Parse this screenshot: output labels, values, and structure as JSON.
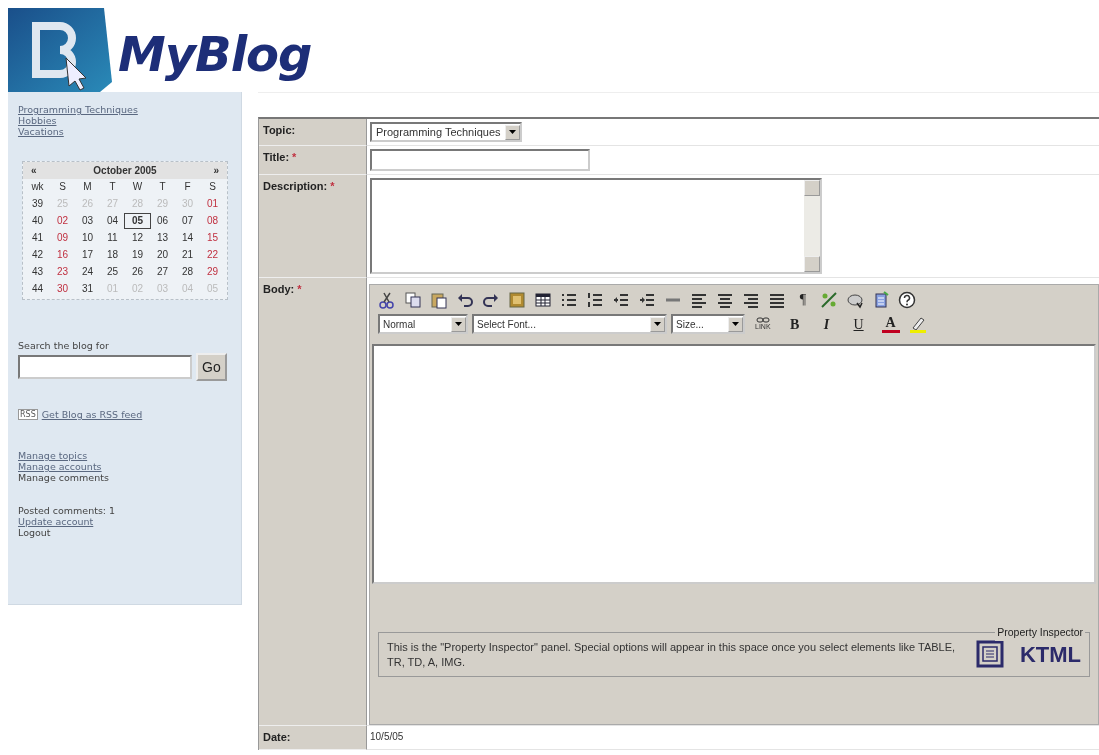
{
  "logo": {
    "text": "MyBlog"
  },
  "sidebar": {
    "topics": [
      {
        "text": "Programming Techniques"
      },
      {
        "text": "Hobbies"
      },
      {
        "text": "Vacations"
      }
    ],
    "calendar": {
      "prev": "«",
      "month": "October 2005",
      "next": "»",
      "headers": [
        "wk",
        "S",
        "M",
        "T",
        "W",
        "T",
        "F",
        "S"
      ],
      "weeks": [
        {
          "wk": "39",
          "days": [
            {
              "text": "25",
              "kind": "other",
              "selected": false
            },
            {
              "text": "26",
              "kind": "other",
              "selected": false
            },
            {
              "text": "27",
              "kind": "other",
              "selected": false
            },
            {
              "text": "28",
              "kind": "other",
              "selected": false
            },
            {
              "text": "29",
              "kind": "other",
              "selected": false
            },
            {
              "text": "30",
              "kind": "other",
              "selected": false
            },
            {
              "text": "01",
              "kind": "weekend",
              "selected": false
            }
          ]
        },
        {
          "wk": "40",
          "days": [
            {
              "text": "02",
              "kind": "weekend",
              "selected": false
            },
            {
              "text": "03",
              "kind": "normal",
              "selected": false
            },
            {
              "text": "04",
              "kind": "normal",
              "selected": false
            },
            {
              "text": "05",
              "kind": "normal",
              "selected": true
            },
            {
              "text": "06",
              "kind": "normal",
              "selected": false
            },
            {
              "text": "07",
              "kind": "normal",
              "selected": false
            },
            {
              "text": "08",
              "kind": "weekend",
              "selected": false
            }
          ]
        },
        {
          "wk": "41",
          "days": [
            {
              "text": "09",
              "kind": "weekend",
              "selected": false
            },
            {
              "text": "10",
              "kind": "normal",
              "selected": false
            },
            {
              "text": "11",
              "kind": "normal",
              "selected": false
            },
            {
              "text": "12",
              "kind": "normal",
              "selected": false
            },
            {
              "text": "13",
              "kind": "normal",
              "selected": false
            },
            {
              "text": "14",
              "kind": "normal",
              "selected": false
            },
            {
              "text": "15",
              "kind": "weekend",
              "selected": false
            }
          ]
        },
        {
          "wk": "42",
          "days": [
            {
              "text": "16",
              "kind": "weekend",
              "selected": false
            },
            {
              "text": "17",
              "kind": "normal",
              "selected": false
            },
            {
              "text": "18",
              "kind": "normal",
              "selected": false
            },
            {
              "text": "19",
              "kind": "normal",
              "selected": false
            },
            {
              "text": "20",
              "kind": "normal",
              "selected": false
            },
            {
              "text": "21",
              "kind": "normal",
              "selected": false
            },
            {
              "text": "22",
              "kind": "weekend",
              "selected": false
            }
          ]
        },
        {
          "wk": "43",
          "days": [
            {
              "text": "23",
              "kind": "weekend",
              "selected": false
            },
            {
              "text": "24",
              "kind": "normal",
              "selected": false
            },
            {
              "text": "25",
              "kind": "normal",
              "selected": false
            },
            {
              "text": "26",
              "kind": "normal",
              "selected": false
            },
            {
              "text": "27",
              "kind": "normal",
              "selected": false
            },
            {
              "text": "28",
              "kind": "normal",
              "selected": false
            },
            {
              "text": "29",
              "kind": "weekend",
              "selected": false
            }
          ]
        },
        {
          "wk": "44",
          "days": [
            {
              "text": "30",
              "kind": "weekend",
              "selected": false
            },
            {
              "text": "31",
              "kind": "normal",
              "selected": false
            },
            {
              "text": "01",
              "kind": "other",
              "selected": false
            },
            {
              "text": "02",
              "kind": "other",
              "selected": false
            },
            {
              "text": "03",
              "kind": "other",
              "selected": false
            },
            {
              "text": "04",
              "kind": "other",
              "selected": false
            },
            {
              "text": "05",
              "kind": "other",
              "selected": false
            }
          ]
        }
      ]
    },
    "search": {
      "label": "Search the blog for",
      "button": "Go"
    },
    "rss": {
      "badge": "RSS",
      "link": "Get Blog as RSS feed"
    },
    "admin_links": [
      {
        "text": "Manage topics",
        "kind": "link"
      },
      {
        "text": "Manage accounts",
        "kind": "link"
      },
      {
        "text": "Manage comments",
        "kind": "text"
      }
    ],
    "posted_comments": "Posted comments: 1",
    "account_links": [
      {
        "text": "Update account",
        "kind": "link"
      },
      {
        "text": "Logout",
        "kind": "text"
      }
    ]
  },
  "form": {
    "required_mark": "*",
    "rows": [
      {
        "label": "Topic:",
        "required": false,
        "kind": "select",
        "value": "Programming Techniques"
      },
      {
        "label": "Title:",
        "required": true,
        "kind": "text"
      },
      {
        "label": "Description:",
        "required": true,
        "kind": "textarea"
      },
      {
        "label": "Body:",
        "required": true,
        "kind": "editor"
      },
      {
        "label": "Date:",
        "required": false,
        "kind": "static",
        "value": "10/5/05"
      }
    ]
  },
  "editor": {
    "pilcrow": "¶",
    "block_format": "Normal",
    "font": "Select Font...",
    "size": "Size...",
    "link_label": "LINK",
    "format_buttons": [
      {
        "label": "B",
        "kind": "bold"
      },
      {
        "label": "I",
        "kind": "italic"
      },
      {
        "label": "U",
        "kind": "underline"
      },
      {
        "label": "A",
        "kind": "color"
      }
    ],
    "inspector": {
      "legend": "Property Inspector",
      "text": "This is the \"Property Inspector\" panel. Special options will appear in this space once you select elements like TABLE, TR, TD, A, IMG.",
      "brand": "KTML"
    }
  }
}
